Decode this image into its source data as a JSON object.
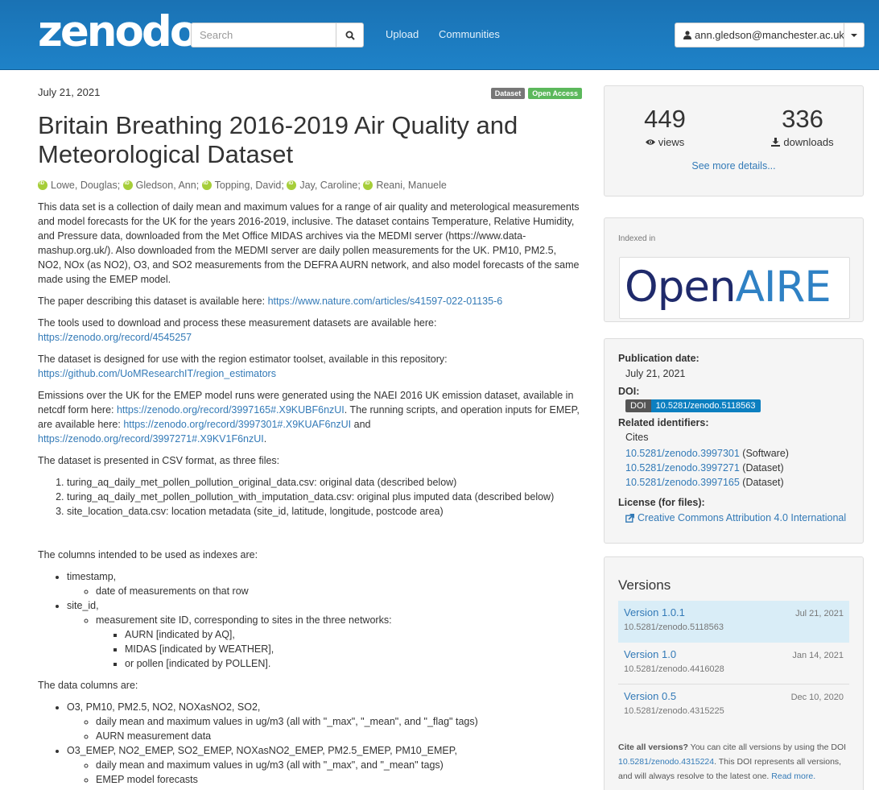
{
  "header": {
    "logo": "zenodo",
    "search_placeholder": "Search",
    "nav": [
      "Upload",
      "Communities"
    ],
    "user": "ann.gledson@manchester.ac.uk"
  },
  "record": {
    "date": "July 21, 2021",
    "badges": [
      "Dataset",
      "Open Access"
    ],
    "title": "Britain Breathing 2016-2019 Air Quality and Meteorological Dataset",
    "authors": [
      "Lowe, Douglas;",
      "Gledson, Ann;",
      "Topping, David;",
      "Jay, Caroline;",
      "Reani, Manuele"
    ],
    "p1": "This data set is a collection of daily mean and maximum values for a range of air quality and meterological measurements and model forecasts for the UK for the years 2016-2019, inclusive. The dataset contains Temperature, Relative Humidity, and Pressure data, downloaded from the Met Office MIDAS archives via the MEDMI server (https://www.data-mashup.org.uk/). Also downloaded from the MEDMI server are daily pollen measurements for the UK. PM10, PM2.5, NO2, NOx (as NO2), O3, and SO2 measurements from the DEFRA AURN network, and also model forecasts of the same made using the EMEP model.",
    "p2_text": "The paper describing this dataset is available here: ",
    "p2_link": "https://www.nature.com/articles/s41597-022-01135-6",
    "p3_text": "The tools used to download and process these measurement datasets are available here: ",
    "p3_link": "https://zenodo.org/record/4545257",
    "p4_text": "The dataset is designed for use with the region estimator toolset, available in this repository: ",
    "p4_link": "https://github.com/UoMResearchIT/region_estimators",
    "p5_text_a": "Emissions over the UK for the EMEP model runs were generated using the NAEI 2016 UK emission dataset, available in netcdf form here: ",
    "p5_link_a": "https://zenodo.org/record/3997165#.X9KUBF6nzUI",
    "p5_text_b": ". The running scripts, and operation inputs for EMEP, are available here: ",
    "p5_link_b": "https://zenodo.org/record/3997301#.X9KUAF6nzUI",
    "p5_text_c": " and ",
    "p5_link_c": "https://zenodo.org/record/3997271#.X9KV1F6nzUI",
    "p5_text_d": ".",
    "p6": "The dataset is presented in CSV format, as three files:",
    "files": [
      "turing_aq_daily_met_pollen_pollution_original_data.csv: original data (described below)",
      "turing_aq_daily_met_pollen_pollution_with_imputation_data.csv: original plus imputed data (described below)",
      "site_location_data.csv: location metadata (site_id, latitude, longitude, postcode area)"
    ],
    "p7": "The columns intended to be used as indexes are:",
    "idx_timestamp": "timestamp,",
    "idx_timestamp_desc": "date of measurements on that row",
    "idx_site": "site_id,",
    "idx_site_desc": "measurement site ID, corresponding to sites in the three networks:",
    "idx_site_nets": [
      "AURN [indicated by AQ],",
      "MIDAS [indicated by WEATHER],",
      "or pollen [indicated by POLLEN]."
    ],
    "p8": "The data columns are:",
    "col1": "O3, PM10, PM2.5, NO2, NOXasNO2, SO2,",
    "col1_sub": [
      "daily mean and maximum values in ug/m3 (all with \"_max\", \"_mean\", and \"_flag\" tags)",
      "AURN measurement data"
    ],
    "col2": "O3_EMEP, NO2_EMEP, SO2_EMEP, NOXasNO2_EMEP, PM2.5_EMEP, PM10_EMEP,",
    "col2_sub": [
      "daily mean and maximum values in ug/m3 (all with \"_max\", and \"_mean\" tags)",
      "EMEP model forecasts"
    ]
  },
  "stats": {
    "views": "449",
    "views_label": "views",
    "downloads": "336",
    "downloads_label": "downloads",
    "more": "See more details..."
  },
  "indexed": {
    "label": "Indexed in",
    "logo_a": "Open",
    "logo_b": "AIRE"
  },
  "info": {
    "pub_label": "Publication date:",
    "pub_value": "July 21, 2021",
    "doi_label": "DOI:",
    "doi_key": "DOI",
    "doi_value": "10.5281/zenodo.5118563",
    "related_label": "Related identifiers:",
    "cites": "Cites",
    "related": [
      {
        "id": "10.5281/zenodo.3997301",
        "type": " (Software)"
      },
      {
        "id": "10.5281/zenodo.3997271",
        "type": " (Dataset)"
      },
      {
        "id": "10.5281/zenodo.3997165",
        "type": " (Dataset)"
      }
    ],
    "license_label": "License (for files):",
    "license_value": "Creative Commons Attribution 4.0 International"
  },
  "versions": {
    "title": "Versions",
    "items": [
      {
        "name": "Version 1.0.1",
        "doi": "10.5281/zenodo.5118563",
        "date": "Jul 21, 2021"
      },
      {
        "name": "Version 1.0",
        "doi": "10.5281/zenodo.4416028",
        "date": "Jan 14, 2021"
      },
      {
        "name": "Version 0.5",
        "doi": "10.5281/zenodo.4315225",
        "date": "Dec 10, 2020"
      }
    ],
    "cite_bold": "Cite all versions?",
    "cite_text": " You can cite all versions by using the DOI ",
    "cite_doi": "10.5281/zenodo.4315224",
    "cite_text2": ". This DOI represents all versions, and will always resolve to the latest one. ",
    "read_more": "Read more."
  },
  "colors": {
    "navbar": "#1e7ec3",
    "link": "#337ab7",
    "dataset_badge": "#777777",
    "open_access_badge": "#5cb85c",
    "doi_value_bg": "#0c7fc0",
    "active_version_bg": "#d9edf7"
  }
}
